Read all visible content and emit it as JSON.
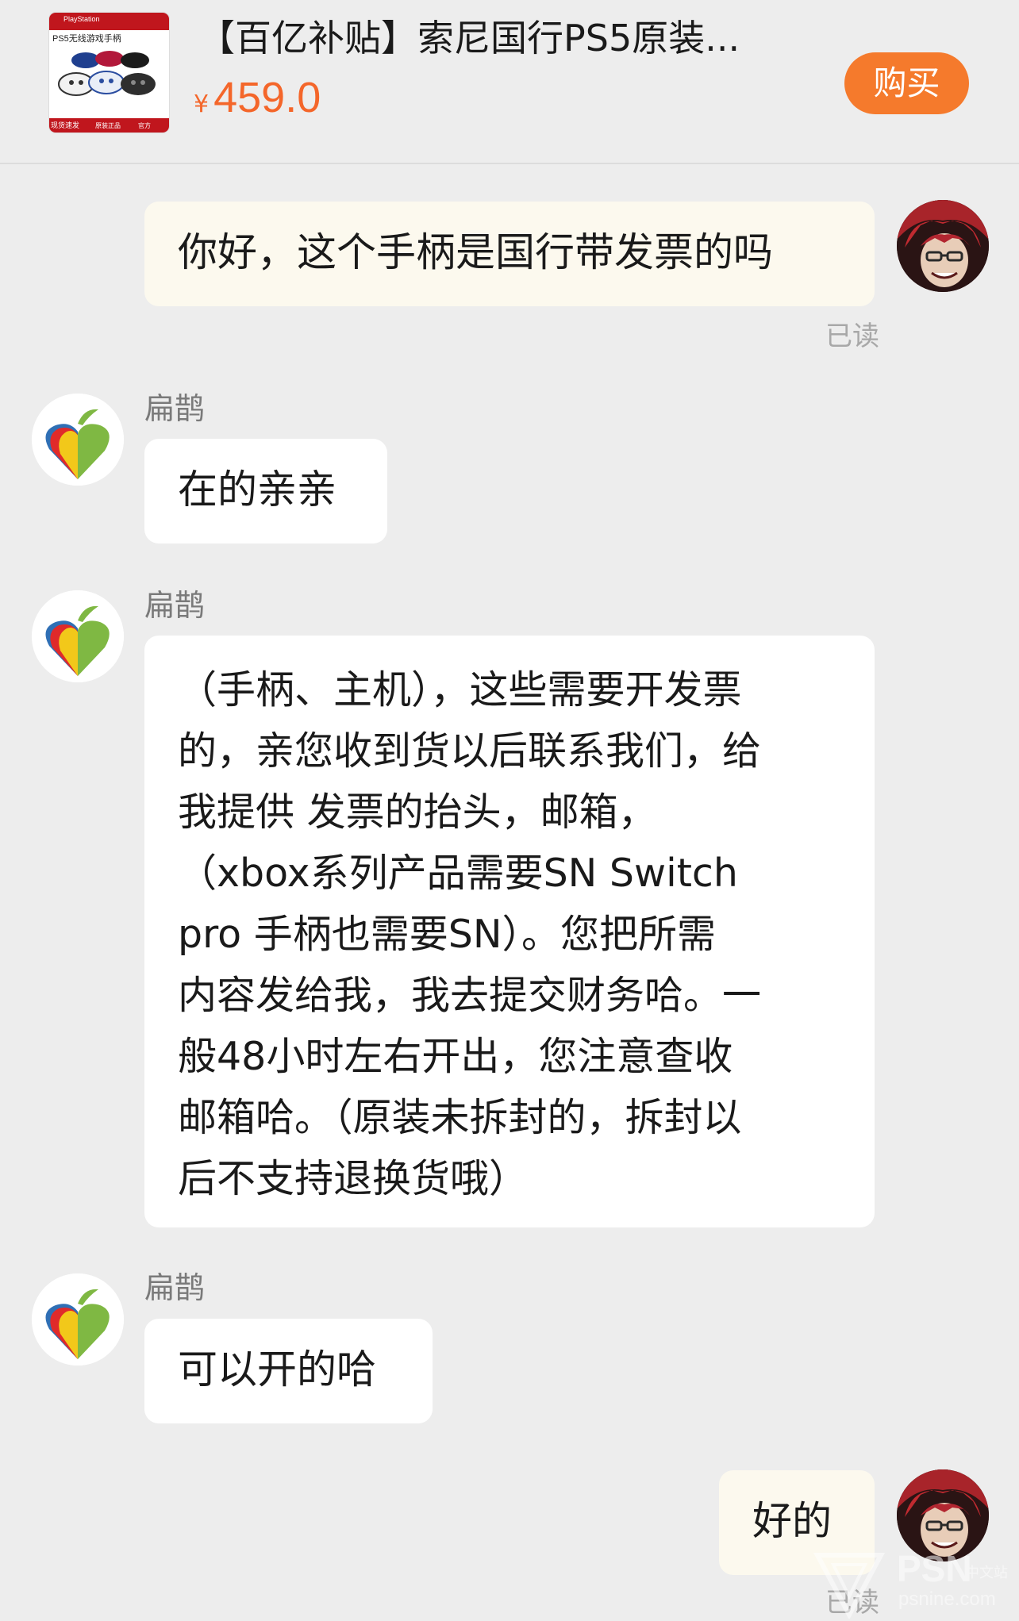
{
  "product": {
    "thumbnail": {
      "brand": "PlayStation",
      "title": "PS5无线游戏手柄",
      "badges": [
        "现货速发",
        "原装正品",
        "官方"
      ]
    },
    "title": "【百亿补贴】索尼国行PS5原装...",
    "currency": "¥",
    "price": "459.0",
    "buy_label": "购买"
  },
  "messages": [
    {
      "sender": "me",
      "text": "你好，这个手柄是国行带发票的吗",
      "status": "已读"
    },
    {
      "sender": "shop",
      "name": "扁鹊",
      "text": "在的亲亲"
    },
    {
      "sender": "shop",
      "name": "扁鹊",
      "lines": [
        "（手柄、主机），这些需要开发票",
        "的，亲您收到货以后联系我们，给",
        "我提供 发票的抬头，邮箱，",
        "（xbox系列产品需要SN  Switch",
        "pro 手柄也需要SN）。您把所需",
        "内容发给我，我去提交财务哈。一",
        "般48小时左右开出，您注意查收",
        "邮箱哈。（原装未拆封的，拆封以",
        "后不支持退换货哦）"
      ]
    },
    {
      "sender": "shop",
      "name": "扁鹊",
      "text": "可以开的哈"
    },
    {
      "sender": "me",
      "text": "好的",
      "status": "已读"
    }
  ],
  "watermark": {
    "brand": "PSN",
    "site": "psnine.com",
    "tag": "中文站"
  },
  "colors": {
    "accent": "#f57a2c",
    "price": "#f4662a",
    "my_bubble": "#fcf9ee",
    "their_bubble": "#ffffff",
    "background": "#ededed"
  }
}
